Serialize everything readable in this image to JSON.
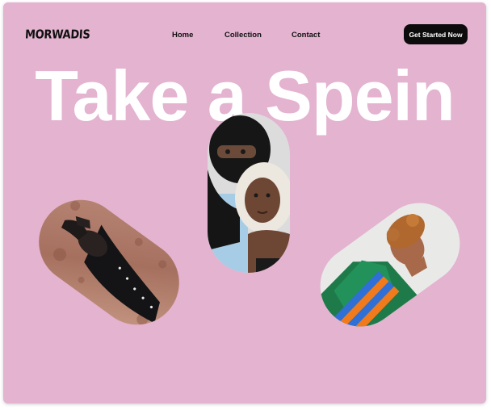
{
  "brand": {
    "logo_text": "MORWADIS"
  },
  "nav": {
    "items": [
      {
        "label": "Home"
      },
      {
        "label": "Collection"
      },
      {
        "label": "Contact"
      }
    ],
    "cta_label": "Get Started Now"
  },
  "hero": {
    "headline": "Take a Spein"
  },
  "colors": {
    "background": "#e3b3d0",
    "headline": "#ffffff",
    "cta_background": "#0c0c0c",
    "cta_text": "#ffffff"
  },
  "photos": [
    {
      "name": "photo-person-lying-on-dirt"
    },
    {
      "name": "photo-two-people-in-knit-hats"
    },
    {
      "name": "photo-person-in-colorful-sweater"
    }
  ]
}
